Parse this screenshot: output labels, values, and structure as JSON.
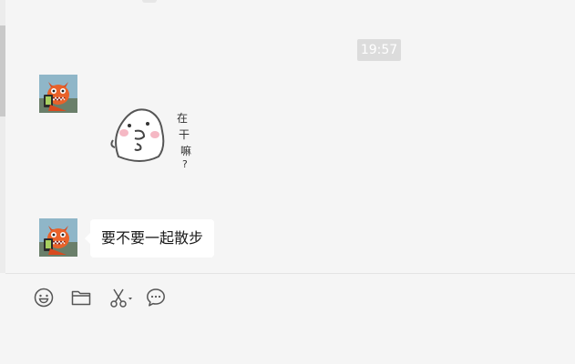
{
  "chat": {
    "timestamp": "19:57",
    "messages": [
      {
        "type": "sticker",
        "sticker_text": "在干嘛?"
      },
      {
        "type": "text",
        "text": "要不要一起散步"
      }
    ]
  },
  "toolbar": {
    "icons": [
      "emoji-icon",
      "folder-icon",
      "scissors-icon",
      "chat-history-icon"
    ]
  },
  "colors": {
    "background": "#f5f5f5",
    "bubble": "#ffffff",
    "timestamp_bg": "#dcdcdc",
    "icon": "#555555"
  }
}
